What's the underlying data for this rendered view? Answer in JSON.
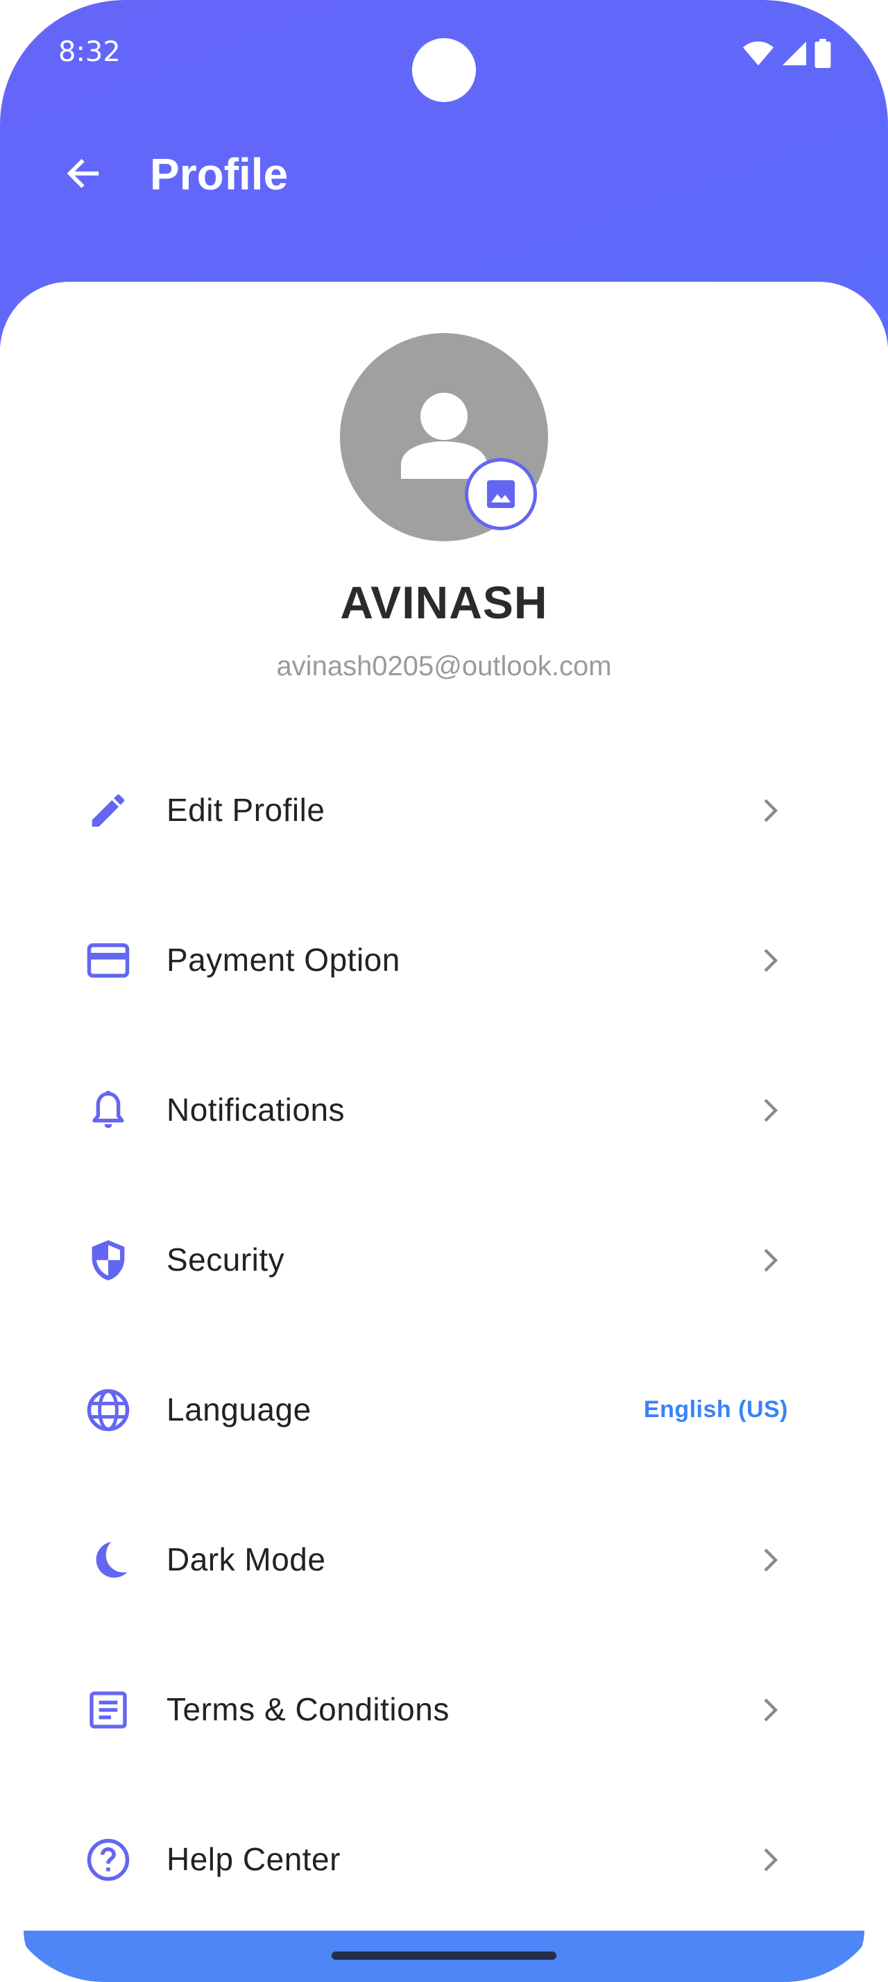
{
  "status_bar": {
    "time": "8:32"
  },
  "toolbar": {
    "title": "Profile",
    "back_icon": "arrow-back-icon"
  },
  "profile": {
    "name": "AVINASH",
    "email": "avinash0205@outlook.com",
    "avatar_icon": "person-icon",
    "badge_icon": "image-icon"
  },
  "menu": {
    "items": [
      {
        "label": "Edit Profile",
        "icon": "pencil-icon"
      },
      {
        "label": "Payment Option",
        "icon": "credit-card-icon"
      },
      {
        "label": "Notifications",
        "icon": "bell-icon"
      },
      {
        "label": "Security",
        "icon": "shield-icon"
      },
      {
        "label": "Language",
        "icon": "globe-icon",
        "value": "English (US)"
      },
      {
        "label": "Dark Mode",
        "icon": "moon-icon"
      },
      {
        "label": "Terms & Conditions",
        "icon": "document-icon"
      },
      {
        "label": "Help Center",
        "icon": "help-circle-icon"
      }
    ]
  },
  "colors": {
    "accent": "#6366f1",
    "header": "#6366f8",
    "link": "#3b82f6",
    "bottom_bar": "#4f86f7"
  }
}
